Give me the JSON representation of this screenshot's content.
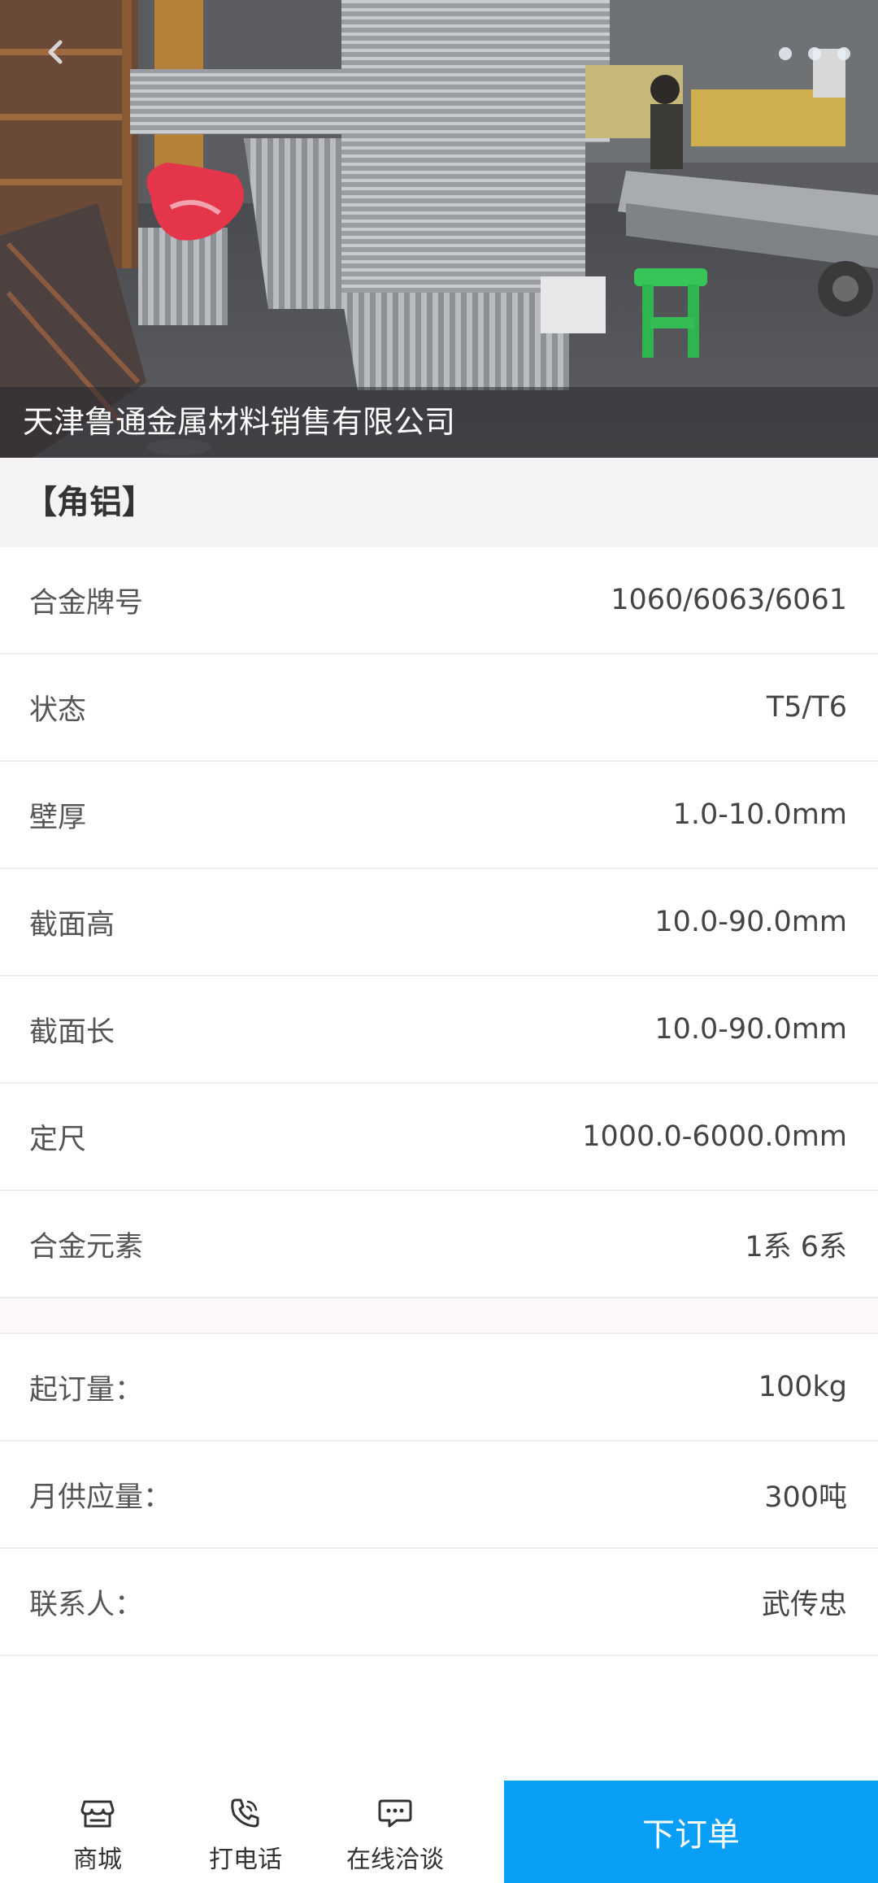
{
  "hero": {
    "company_name": "天津鲁通金属材料销售有限公司"
  },
  "product": {
    "title": "【角铝】"
  },
  "specs": [
    {
      "label": "合金牌号",
      "value": "1060/6063/6061"
    },
    {
      "label": "状态",
      "value": "T5/T6"
    },
    {
      "label": "壁厚",
      "value": "1.0-10.0mm"
    },
    {
      "label": "截面高",
      "value": "10.0-90.0mm"
    },
    {
      "label": "截面长",
      "value": "10.0-90.0mm"
    },
    {
      "label": "定尺",
      "value": "1000.0-6000.0mm"
    },
    {
      "label": "合金元素",
      "value": "1系 6系"
    }
  ],
  "supply": [
    {
      "label": "起订量：",
      "value": "100kg"
    },
    {
      "label": "月供应量：",
      "value": "300吨"
    },
    {
      "label": "联系人：",
      "value": "武传忠"
    }
  ],
  "bottom_bar": {
    "shop_label": "商城",
    "call_label": "打电话",
    "chat_label": "在线洽谈",
    "order_label": "下订单"
  },
  "icons": {
    "back": "chevron-left-icon",
    "more": "more-dots-icon",
    "shop": "store-icon",
    "call": "phone-icon",
    "chat": "chat-bubble-icon"
  },
  "colors": {
    "accent": "#0a9ff7",
    "title_band": "#f6f3f6"
  }
}
